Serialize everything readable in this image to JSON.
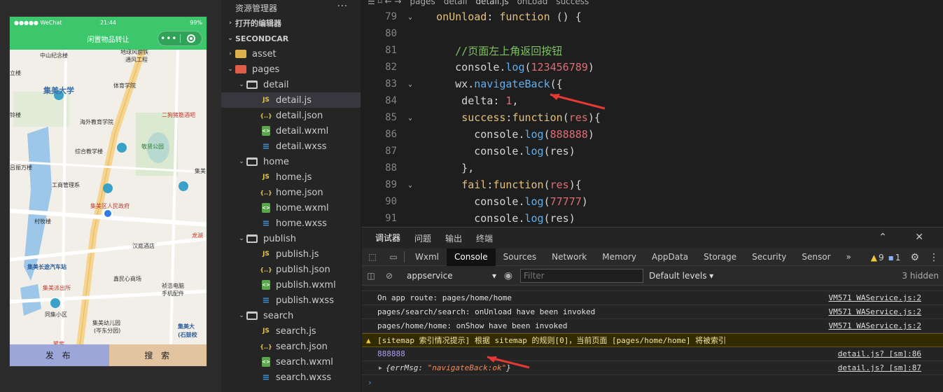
{
  "simulator": {
    "status": {
      "carrier": "●●●●● WeChat",
      "time": "21:44",
      "battery": "99%"
    },
    "nav_title": "闲置物品转让",
    "capsule_more": "•••",
    "map_labels": [
      {
        "text": "中山纪念楼",
        "cls": ""
      },
      {
        "text": "地球风貌铁",
        "cls": ""
      },
      {
        "text": "通风工程",
        "cls": ""
      },
      {
        "text": "立楼",
        "cls": ""
      },
      {
        "text": "集美大学",
        "cls": "big"
      },
      {
        "text": "体育学院",
        "cls": ""
      },
      {
        "text": "二狗猪筋酒吧",
        "cls": "red"
      },
      {
        "text": "铃楼",
        "cls": ""
      },
      {
        "text": "海外教育学院",
        "cls": ""
      },
      {
        "text": "综合教学楼",
        "cls": ""
      },
      {
        "text": "敬贤公园",
        "cls": "green"
      },
      {
        "text": "吕振万楼",
        "cls": ""
      },
      {
        "text": "集美",
        "cls": ""
      },
      {
        "text": "工商管理系",
        "cls": ""
      },
      {
        "text": "集美区人民政府",
        "cls": "red"
      },
      {
        "text": "村牧楼",
        "cls": ""
      },
      {
        "text": "汉庭酒店",
        "cls": ""
      },
      {
        "text": "龙湖",
        "cls": "red"
      },
      {
        "text": "集美长途汽车站",
        "cls": "blue"
      },
      {
        "text": "鑫民心商场",
        "cls": ""
      },
      {
        "text": "集美派出所",
        "cls": "red"
      },
      {
        "text": "祯浩电脑",
        "cls": ""
      },
      {
        "text": "手机配件",
        "cls": ""
      },
      {
        "text": "同集小区",
        "cls": ""
      },
      {
        "text": "集美幼儿园",
        "cls": ""
      },
      {
        "text": "(岑东分园)",
        "cls": ""
      },
      {
        "text": "集美大",
        "cls": "blue"
      },
      {
        "text": "(石鼓校",
        "cls": "blue"
      },
      {
        "text": "鹭库",
        "cls": "red"
      }
    ],
    "tabs": {
      "publish": "发 布",
      "search": "搜 索"
    }
  },
  "explorer": {
    "title": "资源管理器",
    "more": "···",
    "open_editors": "打开的编辑器",
    "project": "SECONDCAR",
    "tree": [
      {
        "label": "asset",
        "type": "folder",
        "indent": 1,
        "chev": "›"
      },
      {
        "label": "pages",
        "type": "folder-red",
        "indent": 1,
        "chev": "⌄"
      },
      {
        "label": "detail",
        "type": "folder-open",
        "indent": 2,
        "chev": "⌄"
      },
      {
        "label": "detail.js",
        "type": "js",
        "indent": 3,
        "selected": true
      },
      {
        "label": "detail.json",
        "type": "json",
        "indent": 3
      },
      {
        "label": "detail.wxml",
        "type": "wxml",
        "indent": 3
      },
      {
        "label": "detail.wxss",
        "type": "wxss",
        "indent": 3
      },
      {
        "label": "home",
        "type": "folder-open",
        "indent": 2,
        "chev": "⌄"
      },
      {
        "label": "home.js",
        "type": "js",
        "indent": 3
      },
      {
        "label": "home.json",
        "type": "json",
        "indent": 3
      },
      {
        "label": "home.wxml",
        "type": "wxml",
        "indent": 3
      },
      {
        "label": "home.wxss",
        "type": "wxss",
        "indent": 3
      },
      {
        "label": "publish",
        "type": "folder-open",
        "indent": 2,
        "chev": "⌄"
      },
      {
        "label": "publish.js",
        "type": "js",
        "indent": 3
      },
      {
        "label": "publish.json",
        "type": "json",
        "indent": 3
      },
      {
        "label": "publish.wxml",
        "type": "wxml",
        "indent": 3
      },
      {
        "label": "publish.wxss",
        "type": "wxss",
        "indent": 3
      },
      {
        "label": "search",
        "type": "folder-open",
        "indent": 2,
        "chev": "⌄"
      },
      {
        "label": "search.js",
        "type": "js",
        "indent": 3
      },
      {
        "label": "search.json",
        "type": "json",
        "indent": 3
      },
      {
        "label": "search.wxml",
        "type": "wxml",
        "indent": 3
      },
      {
        "label": "search.wxss",
        "type": "wxss",
        "indent": 3
      }
    ]
  },
  "editor": {
    "breadcrumb": [
      "pages",
      "detail",
      "detail.js",
      "onLoad",
      "success"
    ],
    "lines": [
      {
        "n": "79",
        "fold": "⌄",
        "tokens": [
          [
            "  ",
            ""
          ],
          [
            "onUnload",
            "tk-prop"
          ],
          [
            ": ",
            ""
          ],
          [
            "function",
            "tk-kw"
          ],
          [
            " () {",
            ""
          ]
        ]
      },
      {
        "n": "80",
        "fold": "",
        "tokens": []
      },
      {
        "n": "81",
        "fold": "",
        "tokens": [
          [
            "     ",
            ""
          ],
          [
            "//页面左上角返回按钮",
            "tk-com"
          ]
        ]
      },
      {
        "n": "82",
        "fold": "",
        "tokens": [
          [
            "     console.",
            ""
          ],
          [
            "log",
            "tk-fn"
          ],
          [
            "(",
            ""
          ],
          [
            "123456789",
            "tk-num"
          ],
          [
            ")",
            ""
          ]
        ]
      },
      {
        "n": "83",
        "fold": "⌄",
        "tokens": [
          [
            "     wx.",
            ""
          ],
          [
            "navigateBack",
            "tk-fn"
          ],
          [
            "({",
            ""
          ]
        ]
      },
      {
        "n": "84",
        "fold": "",
        "tokens": [
          [
            "      delta: ",
            ""
          ],
          [
            "1",
            "tk-num"
          ],
          [
            ",",
            ""
          ]
        ]
      },
      {
        "n": "85",
        "fold": "⌄",
        "tokens": [
          [
            "      ",
            ""
          ],
          [
            "success",
            "tk-prop"
          ],
          [
            ":",
            ""
          ],
          [
            "function",
            "tk-kw"
          ],
          [
            "(",
            ""
          ],
          [
            "res",
            "tk-param"
          ],
          [
            "){",
            ""
          ]
        ]
      },
      {
        "n": "86",
        "fold": "",
        "tokens": [
          [
            "        console.",
            ""
          ],
          [
            "log",
            "tk-fn"
          ],
          [
            "(",
            ""
          ],
          [
            "888888",
            "tk-num"
          ],
          [
            ")",
            ""
          ]
        ]
      },
      {
        "n": "87",
        "fold": "",
        "tokens": [
          [
            "        console.",
            ""
          ],
          [
            "log",
            "tk-fn"
          ],
          [
            "(res)",
            ""
          ]
        ]
      },
      {
        "n": "88",
        "fold": "",
        "tokens": [
          [
            "      },",
            ""
          ]
        ]
      },
      {
        "n": "89",
        "fold": "⌄",
        "tokens": [
          [
            "      ",
            ""
          ],
          [
            "fail",
            "tk-prop"
          ],
          [
            ":",
            ""
          ],
          [
            "function",
            "tk-kw"
          ],
          [
            "(",
            ""
          ],
          [
            "res",
            "tk-param"
          ],
          [
            "){",
            ""
          ]
        ]
      },
      {
        "n": "90",
        "fold": "",
        "tokens": [
          [
            "        console.",
            ""
          ],
          [
            "log",
            "tk-fn"
          ],
          [
            "(",
            ""
          ],
          [
            "77777",
            "tk-num"
          ],
          [
            ")",
            ""
          ]
        ]
      },
      {
        "n": "91",
        "fold": "",
        "tokens": [
          [
            "        console.",
            ""
          ],
          [
            "log",
            "tk-fn"
          ],
          [
            "(res)",
            ""
          ]
        ]
      }
    ]
  },
  "devtools": {
    "panel_tabs": [
      "调试器",
      "问题",
      "输出",
      "终端"
    ],
    "active_panel": "调试器",
    "panel_controls": "⌃ ✕",
    "tabs": [
      "Wxml",
      "Console",
      "Sources",
      "Network",
      "Memory",
      "AppData",
      "Storage",
      "Security",
      "Sensor"
    ],
    "active_tab": "Console",
    "more_tabs": "»",
    "warn_count": "9",
    "info_count": "1",
    "context": "appservice",
    "filter_placeholder": "Filter",
    "levels": "Default levels ▾",
    "hidden": "3 hidden",
    "messages": [
      {
        "text": "On app route: pages/home/home",
        "src": "VM571 WAService.js:2",
        "kind": "log"
      },
      {
        "text": "pages/search/search: onUnload have been invoked",
        "src": "VM571 WAService.js:2",
        "kind": "log"
      },
      {
        "text": "pages/home/home: onShow have been invoked",
        "src": "VM571 WAService.js:2",
        "kind": "log"
      },
      {
        "text": "[sitemap 索引情况提示] 根据 sitemap 的规则[0]，当前页面 [pages/home/home] 将被索引",
        "src": "",
        "kind": "warn"
      },
      {
        "text": "888888",
        "src": "detail.js? [sm]:86",
        "kind": "num"
      },
      {
        "text": "{errMsg: ",
        "value": "\"navigateBack:ok\"",
        "end": "}",
        "src": "detail.js? [sm]:87",
        "kind": "obj"
      }
    ],
    "prompt": "›"
  }
}
